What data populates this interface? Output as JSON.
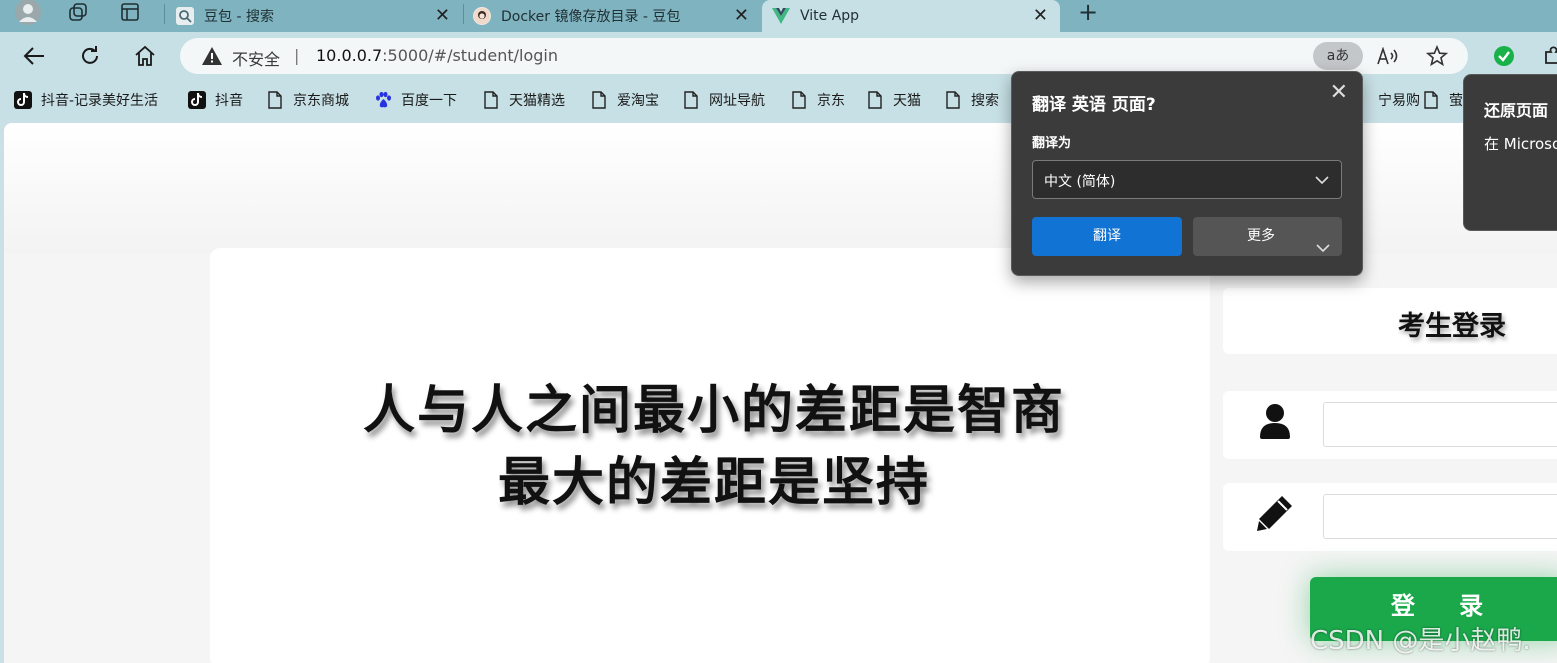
{
  "tabs": [
    {
      "title": "豆包 - 搜索",
      "active": false
    },
    {
      "title": "Docker 镜像存放目录 - 豆包",
      "active": false
    },
    {
      "title": "Vite App",
      "active": true
    }
  ],
  "address": {
    "security_label": "不安全",
    "separator": "|",
    "host": "10.0.0.7",
    "path": ":5000/#/student/login",
    "translate_badge": "aあ"
  },
  "bookmarks": [
    "抖音-记录美好生活",
    "抖音",
    "京东商城",
    "百度一下",
    "天猫精选",
    "爱淘宝",
    "网址导航",
    "京东",
    "天猫",
    "搜索",
    "宁易购",
    "萤"
  ],
  "page": {
    "slogan_line1": "人与人之间最小的差距是智商",
    "slogan_line2": "最大的差距是坚持",
    "panel_title": "考生登录",
    "login_label": "登 录",
    "watermark": "CSDN @是小赵鸭."
  },
  "translate_popup": {
    "title": "翻译 英语 页面?",
    "target_label": "翻译为",
    "target_value": "中文 (简体)",
    "translate_button": "翻译",
    "more_button": "更多"
  },
  "restore_popup": {
    "title": "还原页面",
    "text": "在 Microso"
  },
  "colors": {
    "login_green": "#1aa84b",
    "translate_blue": "#1173d4",
    "tabbar": "#7fb3bf",
    "toolbar": "#c7e0e5"
  }
}
